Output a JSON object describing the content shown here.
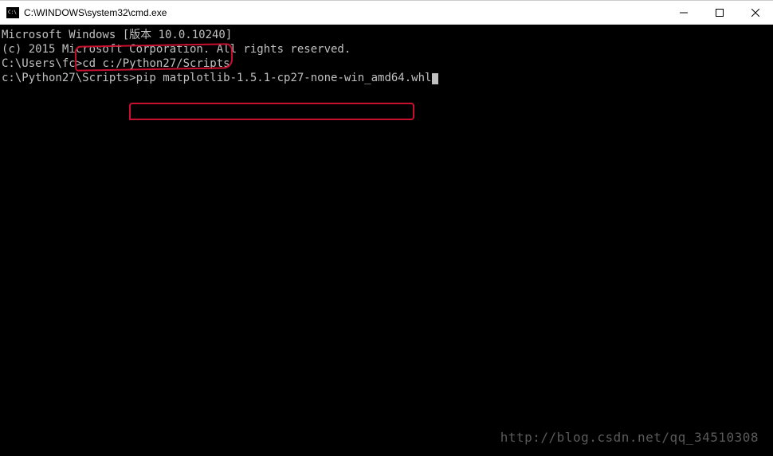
{
  "window": {
    "title": "C:\\WINDOWS\\system32\\cmd.exe"
  },
  "terminal": {
    "line1": "Microsoft Windows [版本 10.0.10240]",
    "line2": "(c) 2015 Microsoft Corporation. All rights reserved.",
    "blank1": "",
    "prompt1": "C:\\Users\\fc>",
    "command1": "cd c:/Python27/Scripts",
    "blank2": "",
    "prompt2": "c:\\Python27\\Scripts>",
    "command2": "pip matplotlib-1.5.1-cp27-none-win_amd64.whl"
  },
  "watermark": "http://blog.csdn.net/qq_34510308"
}
